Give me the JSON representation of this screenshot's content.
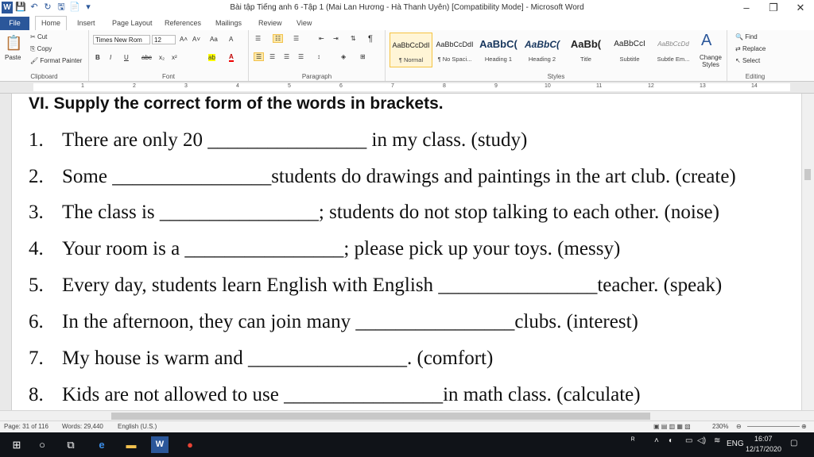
{
  "window": {
    "title": "Bài tập Tiếng anh 6 -Tập 1 (Mai Lan Hương - Hà Thanh Uyên) [Compatibility Mode] - Microsoft Word",
    "controls": [
      "–",
      "❐",
      "✕"
    ]
  },
  "qat": [
    "W",
    "💾",
    "↶",
    "↻",
    "🖫",
    "📄",
    "▾"
  ],
  "tabs": [
    "File",
    "Home",
    "Insert",
    "Page Layout",
    "References",
    "Mailings",
    "Review",
    "View"
  ],
  "ribbon": {
    "clipboard": {
      "label": "Clipboard",
      "paste": "Paste",
      "cut": "Cut",
      "copy": "Copy",
      "format_painter": "Format Painter"
    },
    "font": {
      "label": "Font",
      "name": "Times New Rom",
      "size": "12",
      "bold": "B",
      "italic": "I",
      "underline": "U",
      "strike": "abc",
      "sub": "x₂",
      "sup": "x²",
      "grow": "A˄",
      "shrink": "A˅",
      "case": "Aa",
      "clear": "A",
      "highlight": "ab",
      "color": "A"
    },
    "paragraph": {
      "label": "Paragraph",
      "pilcrow": "¶"
    },
    "styles": {
      "label": "Styles",
      "items": [
        {
          "sample": "AaBbCcDdI",
          "name": "¶ Normal"
        },
        {
          "sample": "AaBbCcDdI",
          "name": "¶ No Spaci..."
        },
        {
          "sample": "AaBbC(",
          "name": "Heading 1"
        },
        {
          "sample": "AaBbC(",
          "name": "Heading 2"
        },
        {
          "sample": "AaBb(",
          "name": "Title"
        },
        {
          "sample": "AaBbCcI",
          "name": "Subtitle"
        },
        {
          "sample": "AaBbCcDd",
          "name": "Subtle Em..."
        }
      ],
      "change": "Change Styles"
    },
    "editing": {
      "label": "Editing",
      "find": "Find",
      "replace": "Replace",
      "select": "Select"
    }
  },
  "ruler": [
    "1",
    "2",
    "3",
    "4",
    "5",
    "6",
    "7",
    "8",
    "9",
    "10",
    "11",
    "12",
    "13",
    "14"
  ],
  "document": {
    "heading": "VI. Supply the correct form of the words in brackets.",
    "items": [
      {
        "num": "1.",
        "before": "There are only 20",
        "blank": "________________",
        "after": "in my class. (study)"
      },
      {
        "num": "2.",
        "before": "Some",
        "blank": "________________",
        "after": "students do drawings and paintings in the art club. (create)"
      },
      {
        "num": "3.",
        "before": "The class is",
        "blank": "________________",
        "after": "; students do not stop talking to each other. (noise)"
      },
      {
        "num": "4.",
        "before": "Your room is a",
        "blank": "________________",
        "after": "; please pick up your toys. (messy)"
      },
      {
        "num": "5.",
        "before": "Every day, students learn English with English",
        "blank": "________________",
        "after": "teacher. (speak)"
      },
      {
        "num": "6.",
        "before": "In the afternoon, they can join many",
        "blank": "________________",
        "after": "clubs. (interest)"
      },
      {
        "num": "7.",
        "before": "My house is warm and",
        "blank": "________________",
        "after": ". (comfort)"
      },
      {
        "num": "8.",
        "before": "Kids are not allowed to use",
        "blank": "________________",
        "after": "in math class. (calculate)"
      }
    ]
  },
  "status": {
    "page": "Page: 31 of 116",
    "words": "Words: 29,440",
    "language": "English (U.S.)",
    "zoom": "230%"
  },
  "taskbar": {
    "tray_lang": "ENG",
    "time": "16:07",
    "date": "12/17/2020"
  },
  "colors": {
    "accent": "#2b579a",
    "taskbar": "#101318"
  }
}
